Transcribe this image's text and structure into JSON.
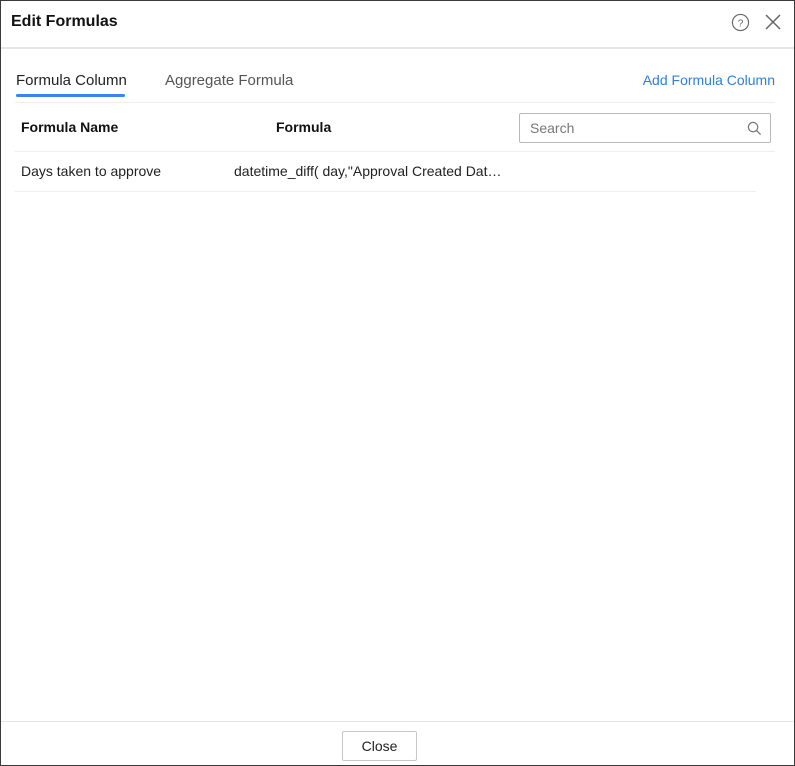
{
  "dialog": {
    "title": "Edit Formulas",
    "help_icon": "help-circle-icon",
    "close_icon": "close-icon"
  },
  "tabs": [
    {
      "label": "Formula Column",
      "active": true
    },
    {
      "label": "Aggregate Formula",
      "active": false
    }
  ],
  "actions": {
    "add_formula_column": "Add Formula Column"
  },
  "table": {
    "columns": [
      "Formula Name",
      "Formula"
    ],
    "rows": [
      {
        "name": "Days taken to approve",
        "formula": "datetime_diff( day,\"Approval Created Date\",.."
      }
    ]
  },
  "search": {
    "placeholder": "Search",
    "value": ""
  },
  "footer": {
    "close_label": "Close"
  },
  "colors": {
    "accent": "#3b82f6",
    "link": "#2f80d8"
  }
}
